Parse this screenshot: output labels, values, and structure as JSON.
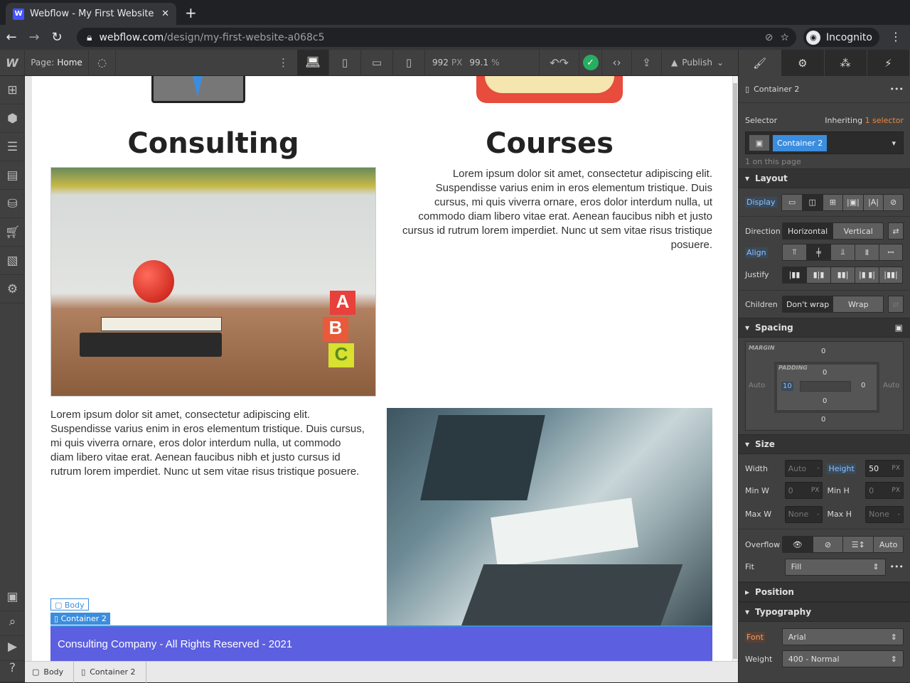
{
  "browser": {
    "tab_title": "Webflow - My First Website",
    "url_host": "webflow.com",
    "url_path": "/design/my-first-website-a068c5",
    "profile": "Incognito"
  },
  "toolbar": {
    "page_label": "Page:",
    "page_name": "Home",
    "width": "992",
    "width_unit": "PX",
    "zoom": "99.1",
    "zoom_unit": "%",
    "publish": "Publish"
  },
  "canvas": {
    "heading_left": "Consulting",
    "heading_right": "Courses",
    "paragraph": "Lorem ipsum dolor sit amet, consectetur adipiscing elit. Suspendisse varius enim in eros elementum tristique. Duis cursus, mi quis viverra ornare, eros dolor interdum nulla, ut commodo diam libero vitae erat. Aenean faucibus nibh et justo cursus id rutrum lorem imperdiet. Nunc ut sem vitae risus tristique posuere.",
    "footer": "Consulting Company - All Rights Reserved - 2021",
    "tag_body": "Body",
    "tag_container": "Container 2"
  },
  "breadcrumb": [
    "Body",
    "Container 2"
  ],
  "panel": {
    "element": "Container 2",
    "selector_label": "Selector",
    "inheriting": "Inheriting",
    "inherit_count": "1 selector",
    "selector_chip": "Container 2",
    "on_page": "1 on this page",
    "layout": {
      "title": "Layout",
      "display": "Display",
      "direction": "Direction",
      "horizontal": "Horizontal",
      "vertical": "Vertical",
      "align": "Align",
      "justify": "Justify",
      "children": "Children",
      "dont_wrap": "Don't wrap",
      "wrap": "Wrap"
    },
    "spacing": {
      "title": "Spacing",
      "margin": "MARGIN",
      "padding": "PADDING",
      "m_top": "0",
      "m_bottom": "0",
      "m_left": "Auto",
      "m_right": "Auto",
      "p_top": "0",
      "p_bottom": "0",
      "p_left": "10",
      "p_right": "0"
    },
    "size": {
      "title": "Size",
      "width": "Width",
      "width_val": "Auto",
      "height": "Height",
      "height_val": "50",
      "min_w": "Min W",
      "min_w_val": "0",
      "min_h": "Min H",
      "min_h_val": "0",
      "max_w": "Max W",
      "max_w_val": "None",
      "max_h": "Max H",
      "max_h_val": "None",
      "px": "PX",
      "dash": "-",
      "overflow": "Overflow",
      "overflow_auto": "Auto",
      "fit": "Fit",
      "fit_val": "Fill"
    },
    "position": {
      "title": "Position"
    },
    "typography": {
      "title": "Typography",
      "font": "Font",
      "font_val": "Arial",
      "weight": "Weight",
      "weight_val": "400 - Normal"
    }
  },
  "colors": {
    "accent": "#3b8dde",
    "footer": "#5c5fe0",
    "inherit": "#f0873a",
    "publish_ok": "#27ae60"
  }
}
